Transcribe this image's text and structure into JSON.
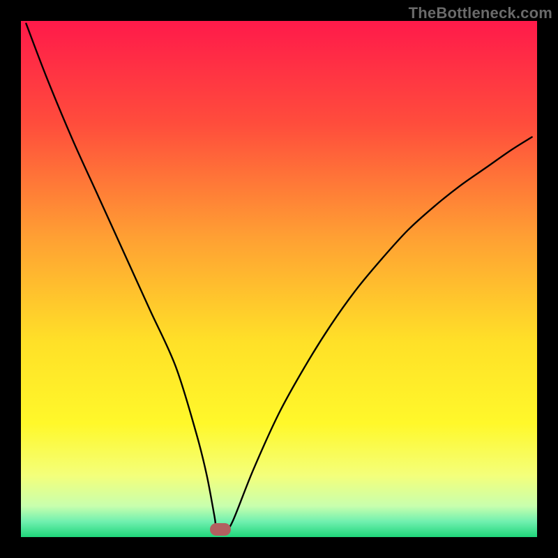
{
  "watermark": "TheBottleneck.com",
  "chart_data": {
    "type": "line",
    "title": "",
    "xlabel": "",
    "ylabel": "",
    "xlim": [
      0,
      100
    ],
    "ylim": [
      0,
      100
    ],
    "grid": false,
    "legend": "none",
    "gradient_stops": [
      {
        "pct": 0,
        "color": "#ff1a4a"
      },
      {
        "pct": 20,
        "color": "#ff4d3c"
      },
      {
        "pct": 42,
        "color": "#ffa033"
      },
      {
        "pct": 62,
        "color": "#ffe028"
      },
      {
        "pct": 78,
        "color": "#fff82a"
      },
      {
        "pct": 88,
        "color": "#f4ff7a"
      },
      {
        "pct": 94,
        "color": "#c8ffae"
      },
      {
        "pct": 97,
        "color": "#70f0af"
      },
      {
        "pct": 100,
        "color": "#1fd67a"
      }
    ],
    "series": [
      {
        "name": "bottleneck-curve",
        "x": [
          1,
          5,
          10,
          15,
          20,
          25,
          30,
          34,
          36,
          37.5,
          38,
          39.5,
          41,
          45,
          50,
          55,
          60,
          65,
          70,
          75,
          80,
          85,
          90,
          95,
          99
        ],
        "y": [
          99.5,
          89,
          77,
          66,
          55,
          44,
          33,
          20,
          12,
          4,
          1.2,
          1.2,
          3,
          13,
          24,
          33,
          41,
          48,
          54,
          59.5,
          64,
          68,
          71.5,
          75,
          77.5
        ]
      }
    ],
    "marker": {
      "name": "optimal-point",
      "x": 38.7,
      "y": 1.5,
      "color": "#b16060"
    }
  }
}
